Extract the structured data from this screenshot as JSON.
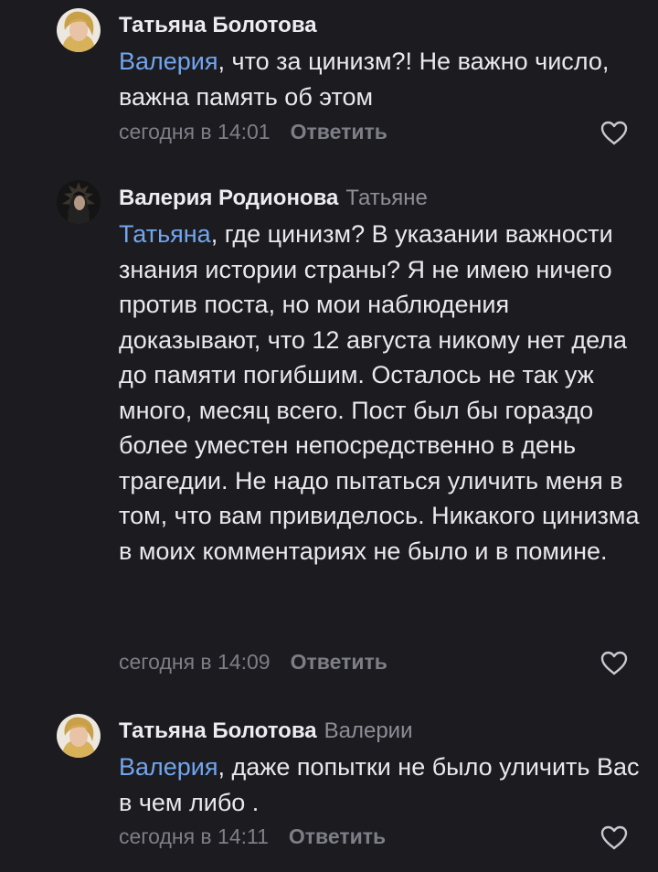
{
  "comments": [
    {
      "author": "Татьяна Болотова",
      "reply_to": "",
      "mention": "Валерия",
      "text": ", что за цинизм?! Не важно число, важна память об этом",
      "time": "сегодня в 14:01",
      "reply_label": "Ответить",
      "like_icon": "heart-outline-icon"
    },
    {
      "author": "Валерия Родионова",
      "reply_to": "Татьяне",
      "mention": "Татьяна",
      "text": ", где цинизм? В указании важности знания истории страны? Я не имею ничего против поста, но мои наблюдения доказывают, что 12 августа никому нет дела до памяти погибшим. Осталось не так уж много, месяц всего. Пост был бы гораздо более уместен непосредственно в день трагедии. Не надо пытаться уличить меня в том, что вам привиделось. Никакого цинизма в моих комментариях не было и в помине.",
      "time": "сегодня в 14:09",
      "reply_label": "Ответить",
      "like_icon": "heart-outline-icon"
    },
    {
      "author": "Татьяна Болотова",
      "reply_to": "Валерии",
      "mention": "Валерия",
      "text": ", даже попытки не было уличить Вас в чем либо .",
      "time": "сегодня в 14:11",
      "reply_label": "Ответить",
      "like_icon": "heart-outline-icon"
    }
  ],
  "colors": {
    "background": "#1c1b20",
    "mention": "#71a6ef",
    "meta": "#7e7e86"
  }
}
